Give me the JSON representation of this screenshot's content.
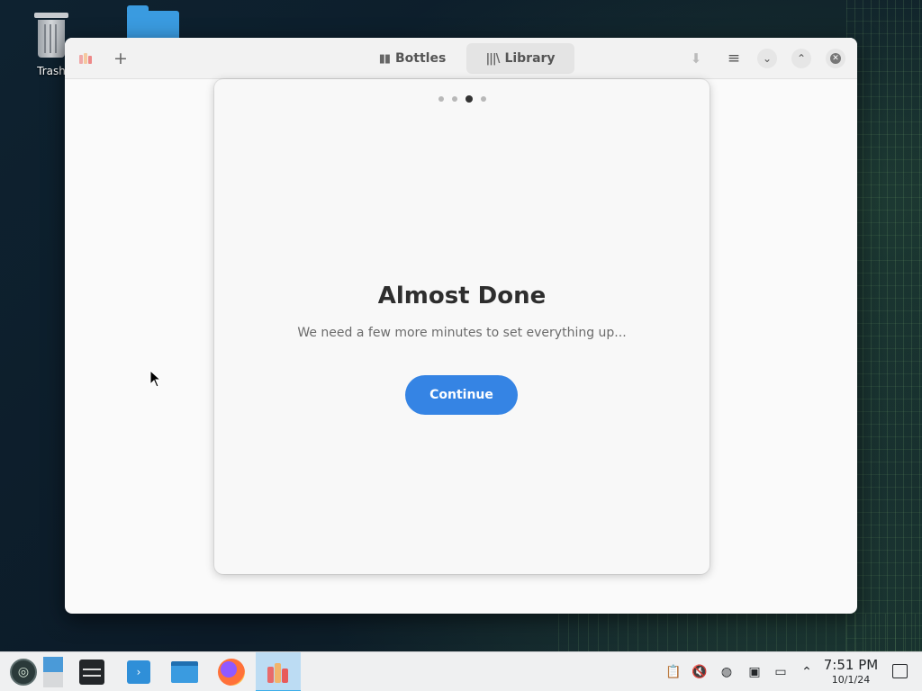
{
  "desktop": {
    "icons": [
      {
        "label": "Trash",
        "icon": "trash-icon"
      },
      {
        "label": "",
        "icon": "folder-icon"
      }
    ]
  },
  "window": {
    "header": {
      "tabs": [
        {
          "label": "Bottles",
          "icon": "bottles-icon",
          "active": false
        },
        {
          "label": "Library",
          "icon": "library-icon",
          "active": true
        }
      ]
    },
    "onboarding": {
      "page_index": 3,
      "page_count": 4,
      "title": "Almost Done",
      "subtitle": "We need a few more minutes to set everything up...",
      "continue_label": "Continue"
    },
    "colors": {
      "accent": "#3584e4"
    }
  },
  "taskbar": {
    "apps": [
      {
        "name": "application-launcher",
        "icon": "opensuse-icon"
      },
      {
        "name": "virtual-desktop-pager",
        "icon": "pager-icon"
      },
      {
        "name": "system-settings",
        "icon": "settings-icon"
      },
      {
        "name": "discover",
        "icon": "discover-icon"
      },
      {
        "name": "dolphin",
        "icon": "folder-icon"
      },
      {
        "name": "firefox",
        "icon": "firefox-icon"
      },
      {
        "name": "bottles",
        "icon": "bottles-app-icon",
        "active": true
      }
    ],
    "tray": [
      "clipboard-icon",
      "volume-muted-icon",
      "network-icon",
      "input-method-icon",
      "display-icon",
      "expand-tray-icon"
    ],
    "clock": {
      "time": "7:51 PM",
      "date": "10/1/24"
    }
  }
}
